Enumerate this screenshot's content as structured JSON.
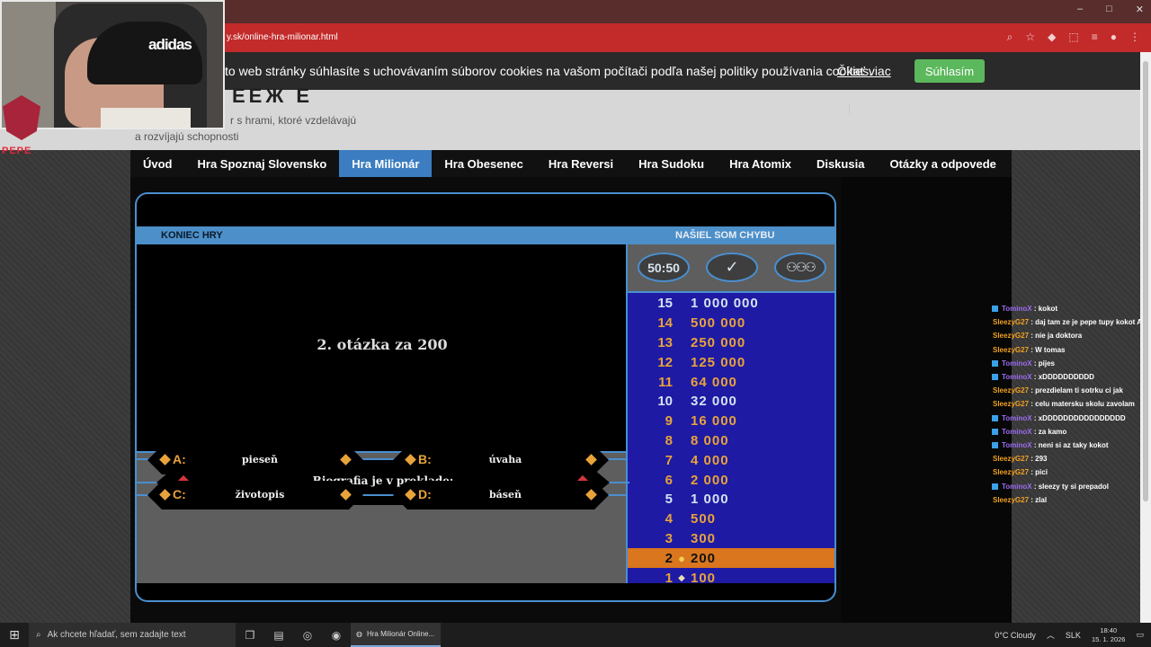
{
  "browser": {
    "url": "y.sk/online-hra-milionar.html",
    "window_controls": [
      "–",
      "□",
      "✕"
    ]
  },
  "cookie": {
    "text": "to web stránky súhlasíte s uchovávaním súborov cookies na vašom počítači podľa našej politiky používania cookies.",
    "link": "Čítať viac",
    "button": "Súhlasím"
  },
  "site": {
    "logo_fragment": "ЕЕЖ Е",
    "tagline_line1": "r s hrami, ktoré vzdelávajú",
    "tagline_line2": "a rozvíjajú schopnosti"
  },
  "nav": [
    "Úvod",
    "Hra Spoznaj Slovensko",
    "Hra Milionár",
    "Hra Obesenec",
    "Hra Reversi",
    "Hra Sudoku",
    "Hra Atomix",
    "Diskusia",
    "Otázky a odpovede"
  ],
  "nav_active_index": 2,
  "game": {
    "end_label": "KONIEC HRY",
    "report_label": "NAŠIEL SOM CHYBU",
    "question_title": "2. otázka za 200",
    "question": "Biografia je v preklade:",
    "answers": {
      "A": {
        "letter": "A:",
        "text": "pieseň"
      },
      "B": {
        "letter": "B:",
        "text": "úvaha"
      },
      "C": {
        "letter": "C:",
        "text": "životopis"
      },
      "D": {
        "letter": "D:",
        "text": "báseň"
      }
    },
    "lifelines": {
      "fifty": "50:50",
      "phone": "phone-icon",
      "audience": "audience-icon"
    },
    "ladder": [
      {
        "num": "15",
        "amount": "1 000 000",
        "milestone": true
      },
      {
        "num": "14",
        "amount": "500 000",
        "milestone": false
      },
      {
        "num": "13",
        "amount": "250 000",
        "milestone": false
      },
      {
        "num": "12",
        "amount": "125 000",
        "milestone": false
      },
      {
        "num": "11",
        "amount": "64 000",
        "milestone": false
      },
      {
        "num": "10",
        "amount": "32 000",
        "milestone": true
      },
      {
        "num": "9",
        "amount": "16 000",
        "milestone": false
      },
      {
        "num": "8",
        "amount": "8 000",
        "milestone": false
      },
      {
        "num": "7",
        "amount": "4 000",
        "milestone": false
      },
      {
        "num": "6",
        "amount": "2 000",
        "milestone": false
      },
      {
        "num": "5",
        "amount": "1 000",
        "milestone": true
      },
      {
        "num": "4",
        "amount": "500",
        "milestone": false
      },
      {
        "num": "3",
        "amount": "300",
        "milestone": false
      },
      {
        "num": "2",
        "amount": "200",
        "milestone": false,
        "current": true,
        "mark": "●"
      },
      {
        "num": "1",
        "amount": "100",
        "milestone": false,
        "mark": "◆"
      }
    ],
    "colors": {
      "frame": "#4a8fd0",
      "ladder_bg": "#1e1aa3",
      "amount": "#e8a33a",
      "current": "#d9761e",
      "diamond_red": "#d0363a"
    }
  },
  "webcam": {
    "brand": "adidas",
    "overlay_label": "PEPE"
  },
  "chat": [
    {
      "user": "TominoX",
      "type": "tom",
      "msg": "kokot"
    },
    {
      "user": "SleezyG27",
      "type": "sle",
      "msg": "daj tam ze je pepe tupy kokot ANO"
    },
    {
      "user": "SleezyG27",
      "type": "sle",
      "msg": "nie ja doktora"
    },
    {
      "user": "SleezyG27",
      "type": "sle",
      "msg": "W tomas"
    },
    {
      "user": "TominoX",
      "type": "tom",
      "msg": "pijes"
    },
    {
      "user": "TominoX",
      "type": "tom",
      "msg": "xDDDDDDDDDD"
    },
    {
      "user": "SleezyG27",
      "type": "sle",
      "msg": "prezdielam ti sotrku ci jak"
    },
    {
      "user": "SleezyG27",
      "type": "sle",
      "msg": "celu matersku skolu zavolam"
    },
    {
      "user": "TominoX",
      "type": "tom",
      "msg": "xDDDDDDDDDDDDDDDD"
    },
    {
      "user": "TominoX",
      "type": "tom",
      "msg": "za kamo"
    },
    {
      "user": "TominoX",
      "type": "tom",
      "msg": "neni si az taky kokot"
    },
    {
      "user": "SleezyG27",
      "type": "sle",
      "msg": "293"
    },
    {
      "user": "SleezyG27",
      "type": "sle",
      "msg": "pici"
    },
    {
      "user": "TominoX",
      "type": "tom",
      "msg": "sleezy ty si prepadol"
    },
    {
      "user": "SleezyG27",
      "type": "sle",
      "msg": "zlal"
    }
  ],
  "taskbar": {
    "search_placeholder": "Ak chcete hľadať, sem zadajte text",
    "app_title": "Hra Milionár Online...",
    "weather": "0°C  Cloudy",
    "lang": "SLK",
    "time": "18:40",
    "date": "15. 1. 2026"
  }
}
